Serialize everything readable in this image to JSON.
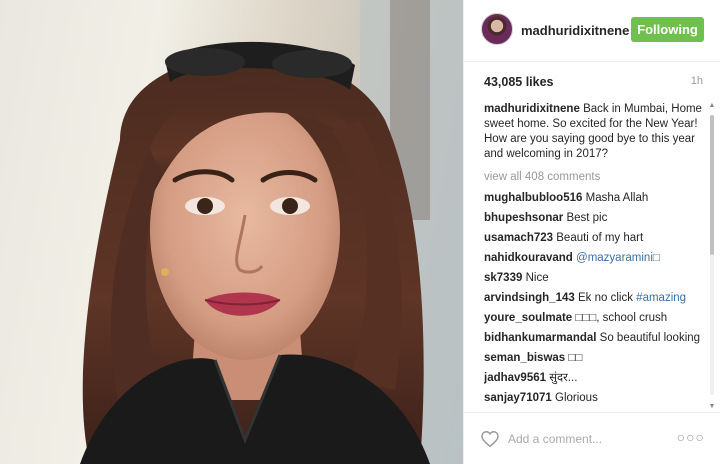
{
  "post": {
    "photo_alt": "",
    "author": {
      "username": "madhuridixitnene",
      "follow_label": "Following"
    },
    "likes": "43,085 likes",
    "time": "1h",
    "caption": {
      "username": "madhuridixitnene",
      "text": "Back in Mumbai, Home sweet home. So excited for the New Year! How are you saying good bye to this year and welcoming in 2017?"
    },
    "view_all": "view all 408 comments",
    "comments": [
      {
        "user": "mughalbubloo516",
        "text": "Masha Allah"
      },
      {
        "user": "bhupeshsonar",
        "text": "Best pic"
      },
      {
        "user": "usamach723",
        "text": "Beauti of my hart"
      },
      {
        "user": "nahidkouravand",
        "text": "@mazyaramini□"
      },
      {
        "user": "sk7339",
        "text": "Nice"
      },
      {
        "user": "arvindsingh_143",
        "text": "Ek no click #amazing"
      },
      {
        "user": "youre_soulmate",
        "text": "□□□, school crush"
      },
      {
        "user": "bidhankumarmandal",
        "text": "So beautiful looking"
      },
      {
        "user": "seman_biswas",
        "text": "□□"
      },
      {
        "user": "jadhav9561",
        "text": "सुंदर..."
      },
      {
        "user": "sanjay71071",
        "text": "Glorious"
      }
    ],
    "add_comment_placeholder": "Add a comment...",
    "more_label": "○○○"
  },
  "icons": {
    "heart": "heart-icon",
    "more": "more-options-icon"
  },
  "colors": {
    "follow_button": "#70c050",
    "link": "#3a6fa8"
  }
}
